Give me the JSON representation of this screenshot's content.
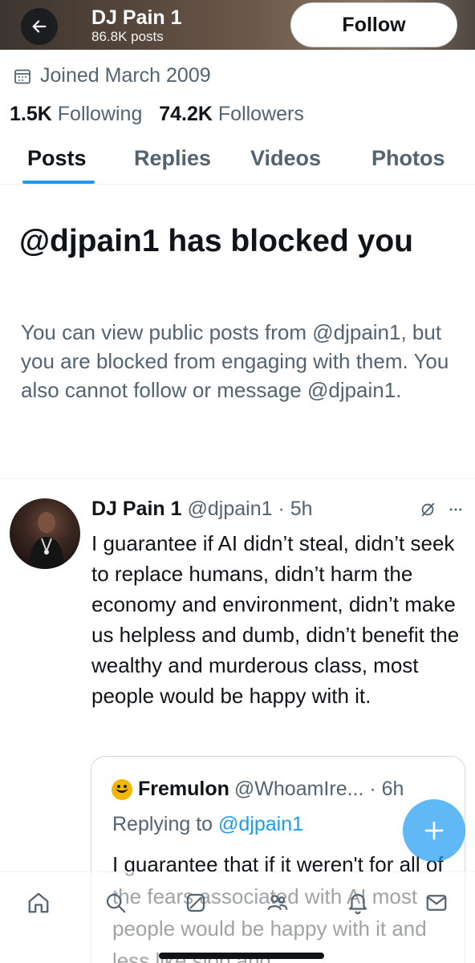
{
  "header": {
    "name": "DJ Pain 1",
    "post_count": "86.8K posts",
    "follow_label": "Follow"
  },
  "profile": {
    "joined": "Joined March 2009",
    "following_count": "1.5K",
    "following_label": "Following",
    "followers_count": "74.2K",
    "followers_label": "Followers"
  },
  "tabs": [
    {
      "label": "Posts",
      "active": true
    },
    {
      "label": "Replies",
      "active": false
    },
    {
      "label": "Videos",
      "active": false
    },
    {
      "label": "Photos",
      "active": false
    }
  ],
  "blocked": {
    "title": "@djpain1 has blocked you",
    "body": "You can view public posts from @djpain1, but you are blocked from engaging with them. You also cannot follow or message @djpain1."
  },
  "tweet": {
    "name": "DJ Pain 1",
    "handle_time": "@djpain1 · 5h",
    "text": "I guarantee if AI didn’t steal, didn’t seek to replace humans, didn’t harm the economy and environment, didn’t make us helpless and dumb, didn’t benefit the wealthy and murderous class, most people would be happy with it."
  },
  "quote": {
    "name": "Fremulon",
    "handle_time": "@WhoamIre... · 6h",
    "replying_label": "Replying to",
    "replying_handle": "@djpain1",
    "text": "I guarantee that if it weren't for all of the fears associated with AI most people would be happy with it and less like slop and"
  },
  "colors": {
    "accent": "#1d9bf0",
    "text_primary": "#0f1419",
    "text_secondary": "#536471",
    "border": "#cfd9de"
  },
  "icons": {
    "back": "arrow-left-icon",
    "calendar": "calendar-icon",
    "grok": "grok-icon",
    "more": "more-horizontal-icon",
    "compose": "plus-icon",
    "nav": [
      "home-icon",
      "search-icon",
      "grok-icon",
      "communities-icon",
      "notifications-icon",
      "messages-icon"
    ]
  }
}
